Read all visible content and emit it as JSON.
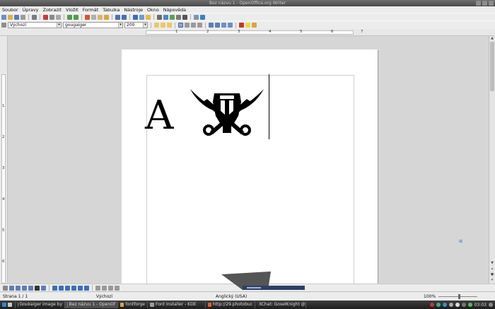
{
  "window": {
    "title": "Bez názvu 1 - OpenOffice.org Writer"
  },
  "menu": [
    "Soubor",
    "Úpravy",
    "Zobrazit",
    "Vložit",
    "Formát",
    "Tabulka",
    "Nástroje",
    "Okno",
    "Nápověda"
  ],
  "formatting": {
    "style": "Výchozí",
    "font": "gougaiger",
    "size": "200"
  },
  "ruler": {
    "h_numbers": [
      "1",
      "2",
      "3",
      "4",
      "5",
      "6",
      "7"
    ],
    "v_numbers": [
      "1",
      "2",
      "3",
      "4",
      "5",
      "6"
    ]
  },
  "document": {
    "text": "A",
    "glyph_icon": "pirate-skull-crossed-swords-icon"
  },
  "status": {
    "page": "Strana 1 / 1",
    "style": "Výchozí",
    "language": "Anglický (USA)",
    "zoom": "100%"
  },
  "taskbar": {
    "tasks": [
      "Goukaiger image by",
      "Bez názvu 1 - OpenOf",
      "fontforge",
      "Font Installer - KDE",
      "http://29.photobuc",
      "XChat: GoselKnight @"
    ],
    "clock": "03:03"
  },
  "colors": {
    "accent_blue": "#3a6fcf",
    "taskbar": "#1d1d1d"
  }
}
